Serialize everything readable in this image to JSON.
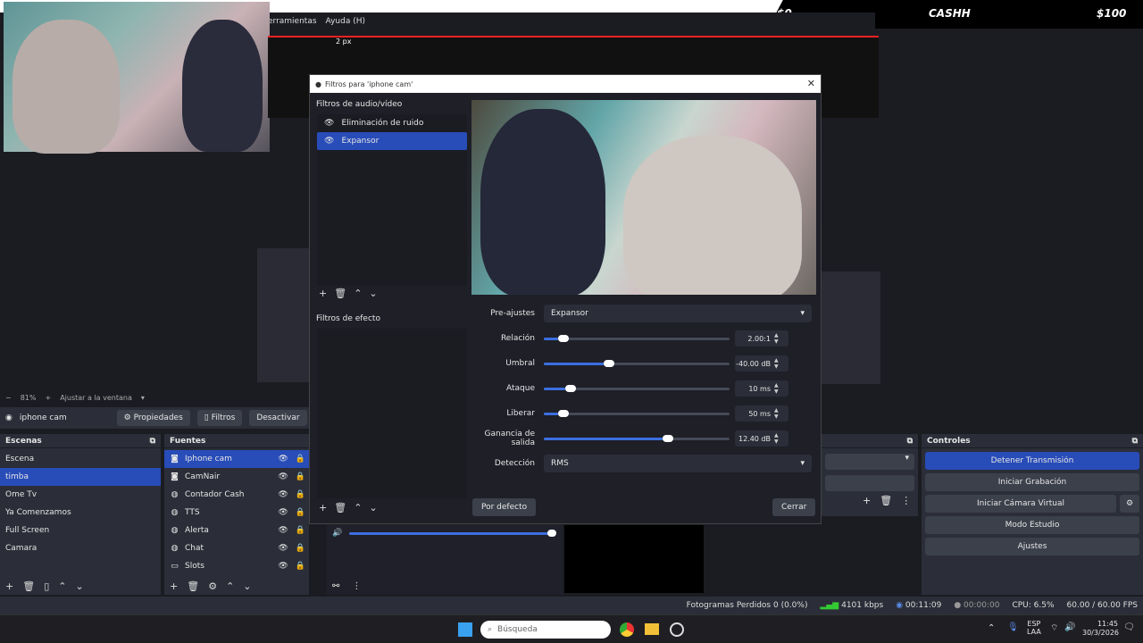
{
  "overlay": {
    "stat1": "$0",
    "stat2": "CASHH",
    "stat3": "$100"
  },
  "menu": {
    "item1": "erramientas",
    "item2": "Ayuda (H)",
    "mini_label": "2 px"
  },
  "preview": {
    "zoom": "81%",
    "fit": "Ajustar a la ventana"
  },
  "source_toolbar": {
    "source_name": "iphone cam",
    "properties": "Propiedades",
    "filters": "Filtros",
    "disable": "Desactivar"
  },
  "scenes": {
    "title": "Escenas",
    "items": [
      "Escena",
      "timba",
      "Ome Tv",
      "Ya Comenzamos",
      "Full Screen",
      "Camara"
    ],
    "selected_index": 1
  },
  "sources": {
    "title": "Fuentes",
    "items": [
      {
        "label": "Iphone cam",
        "icon": "camera-icon"
      },
      {
        "label": "CamNair",
        "icon": "camera-icon"
      },
      {
        "label": "Contador Cash",
        "icon": "globe-icon"
      },
      {
        "label": "TTS",
        "icon": "globe-icon"
      },
      {
        "label": "Alerta",
        "icon": "globe-icon"
      },
      {
        "label": "Chat",
        "icon": "globe-icon"
      },
      {
        "label": "Slots",
        "icon": "monitor-icon"
      }
    ],
    "selected_index": 0
  },
  "controls": {
    "title": "Controles",
    "stop_stream": "Detener Transmisión",
    "start_recording": "Iniciar Grabación",
    "start_virtual_cam": "Iniciar Cámara Virtual",
    "studio_mode": "Modo Estudio",
    "settings": "Ajustes"
  },
  "dialog": {
    "title": "Filtros para 'iphone cam'",
    "audio_video_label": "Filtros de audio/vídeo",
    "audio_filters": [
      "Eliminación de ruido",
      "Expansor"
    ],
    "selected_audio_filter": 1,
    "effects_label": "Filtros de efecto",
    "presets_label": "Pre-ajustes",
    "presets_value": "Expansor",
    "relacion_label": "Relación",
    "relacion_value": "2.00:1",
    "umbral_label": "Umbral",
    "umbral_value": "-40.00 dB",
    "ataque_label": "Ataque",
    "ataque_value": "10 ms",
    "liberar_label": "Liberar",
    "liberar_value": "50 ms",
    "ganancia_label": "Ganancia de salida",
    "ganancia_value": "12.40 dB",
    "deteccion_label": "Detección",
    "deteccion_value": "RMS",
    "defaults_button": "Por defecto",
    "close_button": "Cerrar",
    "slider_levels": {
      "relacion": 0.08,
      "umbral": 0.34,
      "ataque": 0.12,
      "liberar": 0.08,
      "ganancia": 0.68
    }
  },
  "status": {
    "dropped": "Fotogramas Perdidos 0 (0.0%)",
    "bitrate": "4101 kbps",
    "stream_time": "00:11:09",
    "rec_time": "00:00:00",
    "cpu": "CPU: 6.5%",
    "fps": "60.00 / 60.00 FPS"
  },
  "taskbar": {
    "search_placeholder": "Búsqueda",
    "lang1": "ESP",
    "lang2": "LAA",
    "time": "11:45",
    "date": "30/3/2026"
  },
  "colors": {
    "accent": "#284cb8",
    "background": "#1b1c22",
    "panel": "#2b2e38"
  }
}
